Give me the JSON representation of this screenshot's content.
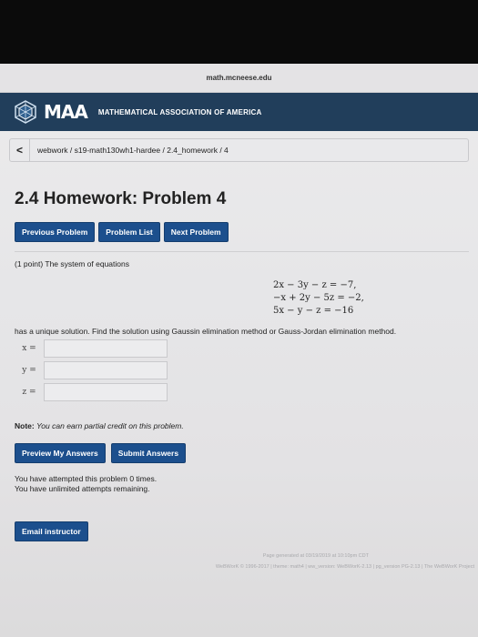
{
  "browser": {
    "url": "math.mcneese.edu"
  },
  "header": {
    "logo": "MAA",
    "org": "MATHEMATICAL ASSOCIATION OF AMERICA"
  },
  "breadcrumb": {
    "back": "<",
    "path": "webwork / s19-math130wh1-hardee / 2.4_homework / 4"
  },
  "page": {
    "title": "2.4 Homework: Problem 4"
  },
  "nav": {
    "previous": "Previous Problem",
    "list": "Problem List",
    "next": "Next Problem"
  },
  "problem": {
    "intro": "(1 point) The system of equations",
    "equations": [
      "2x − 3y − z = −7,",
      "−x + 2y − 5z = −2,",
      "5x − y − z = −16"
    ],
    "question": "has a unique solution. Find the solution using Gaussin elimination method or Gauss-Jordan elimination method.",
    "answers": [
      {
        "label": "x =",
        "value": ""
      },
      {
        "label": "y =",
        "value": ""
      },
      {
        "label": "z =",
        "value": ""
      }
    ]
  },
  "note": {
    "prefix": "Note:",
    "text": "You can earn partial credit on this problem."
  },
  "actions": {
    "preview": "Preview My Answers",
    "submit": "Submit Answers"
  },
  "attempts": {
    "line1": "You have attempted this problem 0 times.",
    "line2": "You have unlimited attempts remaining."
  },
  "email": {
    "label": "Email instructor"
  },
  "footer": {
    "generated": "Page generated at 03/19/2019 at 10:10pm CDT",
    "version": "WeBWorK © 1996-2017 | theme: math4 | ww_version: WeBWorK-2.13 | pg_version PG-2.13 | The WeBWorK Project"
  },
  "colors": {
    "header": "#213e5b",
    "button": "#1c4f8d"
  }
}
